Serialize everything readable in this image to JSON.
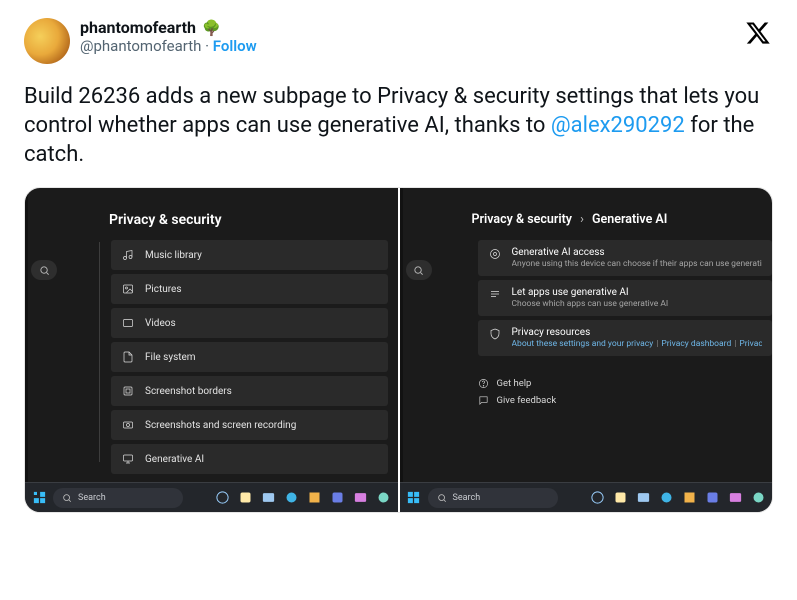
{
  "tweet": {
    "display_name": "phantomofearth",
    "emoji": "🌳",
    "handle": "@phantomofearth",
    "follow_label": "Follow",
    "dot": " · ",
    "text_prefix": "Build 26236 adds a new subpage to Privacy & security settings that lets you control whether apps can use generative AI, thanks to ",
    "mention": "@alex290292",
    "text_suffix": " for the catch."
  },
  "left_pane": {
    "title": "Privacy & security",
    "items": [
      {
        "icon": "music",
        "label": "Music library"
      },
      {
        "icon": "image",
        "label": "Pictures"
      },
      {
        "icon": "video",
        "label": "Videos"
      },
      {
        "icon": "file",
        "label": "File system"
      },
      {
        "icon": "border",
        "label": "Screenshot borders"
      },
      {
        "icon": "capture",
        "label": "Screenshots and screen recording"
      },
      {
        "icon": "monitor",
        "label": "Generative AI"
      }
    ],
    "search_label": "Search"
  },
  "right_pane": {
    "breadcrumb_root": "Privacy & security",
    "breadcrumb_leaf": "Generative AI",
    "cards": [
      {
        "title": "Generative AI access",
        "sub": "Anyone using this device can choose if their apps can use generative AI when this is"
      },
      {
        "title": "Let apps use generative AI",
        "sub": "Choose which apps can use generative AI"
      },
      {
        "title": "Privacy resources",
        "links": [
          "About these settings and your privacy",
          "Privacy dashboard",
          "Privacy Statem"
        ]
      }
    ],
    "help": [
      {
        "icon": "help",
        "label": "Get help"
      },
      {
        "icon": "feedback",
        "label": "Give feedback"
      }
    ],
    "search_label": "Search"
  }
}
